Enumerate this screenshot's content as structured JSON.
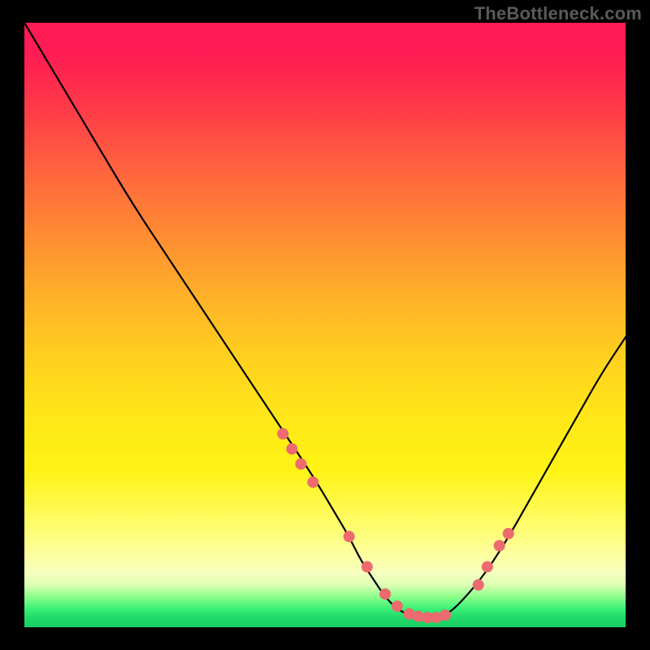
{
  "watermark": "TheBottleneck.com",
  "chart_data": {
    "type": "line",
    "title": "",
    "xlabel": "",
    "ylabel": "",
    "xlim": [
      0,
      100
    ],
    "ylim": [
      0,
      100
    ],
    "series": [
      {
        "name": "curve",
        "x": [
          0,
          6,
          12,
          18,
          24,
          30,
          36,
          42,
          48,
          51,
          54,
          56,
          58,
          60,
          62,
          64,
          66,
          68,
          70,
          72,
          76,
          80,
          84,
          88,
          92,
          96,
          100
        ],
        "y": [
          100,
          90,
          80,
          70,
          61,
          52,
          43,
          34,
          25,
          20,
          15,
          11,
          8,
          5,
          3,
          2,
          1.5,
          1.5,
          2,
          3.5,
          8,
          14,
          21,
          28,
          35,
          42,
          48
        ]
      }
    ],
    "markers": {
      "name": "dots",
      "color": "#ed6a6f",
      "x": [
        43,
        44.5,
        46,
        48,
        54,
        57,
        60,
        62,
        64,
        65.5,
        67,
        68.5,
        70,
        75.5,
        77,
        79,
        80.5
      ],
      "y": [
        32,
        29.5,
        27,
        24,
        15,
        10,
        5.5,
        3.5,
        2.2,
        1.8,
        1.6,
        1.6,
        2,
        7,
        10,
        13.5,
        15.5
      ]
    }
  }
}
